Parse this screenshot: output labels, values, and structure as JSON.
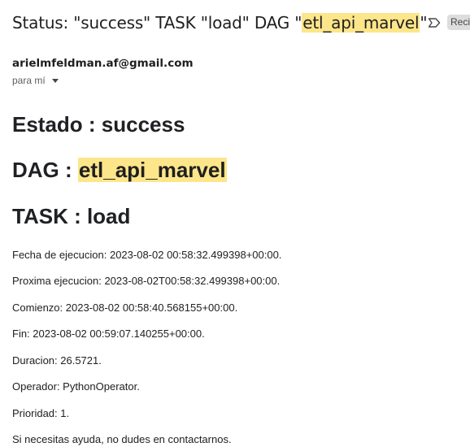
{
  "subject": {
    "before": "Status: \"success\" TASK \"load\" DAG \"",
    "highlight": "etl_api_marvel",
    "after": "\""
  },
  "label": {
    "icon": "label-icon",
    "chip": "Recibidos"
  },
  "sender": {
    "email": "arielmfeldman.af@gmail.com",
    "recipient": "para mí"
  },
  "body": {
    "estado": "Estado : success",
    "dag_prefix": "DAG : ",
    "dag_name": "etl_api_marvel",
    "task": "TASK : load",
    "lines": [
      "Fecha de ejecucion: 2023-08-02 00:58:32.499398+00:00.",
      "Proxima ejecucion: 2023-08-02T00:58:32.499398+00:00.",
      "Comienzo: 2023-08-02 00:58:40.568155+00:00.",
      "Fin: 2023-08-02 00:59:07.140255+00:00.",
      "Duracion: 26.5721.",
      "Operador: PythonOperator.",
      "Prioridad: 1.",
      "Si necesitas ayuda, no dudes en contactarnos."
    ]
  },
  "colors": {
    "highlight": "#fde68a",
    "text": "#1f1f1f"
  }
}
